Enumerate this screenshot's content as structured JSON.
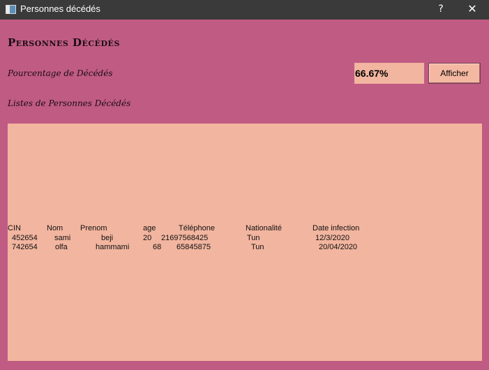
{
  "window": {
    "title": "Personnes décédés",
    "help_glyph": "?",
    "close_glyph": "✕"
  },
  "heading": "Personnes Décédés",
  "percentage": {
    "label": "Pourcentage de Décédés",
    "value": "66.67%",
    "button_label": "Afficher"
  },
  "list": {
    "label": "Listes de Personnes Décédés",
    "headers": [
      "CIN",
      "Nom",
      "Prenom",
      "age",
      "Téléphone",
      "Nationalité",
      "Date infection"
    ],
    "rows": [
      [
        "452654",
        "sami",
        "beji",
        "20",
        "21697568425",
        "Tun",
        "12/3/2020"
      ],
      [
        "742654",
        "olfa",
        "hammami",
        "68",
        "65845875",
        "Tun",
        "20/04/2020"
      ]
    ]
  },
  "colors": {
    "background": "#c05b84",
    "panel": "#f2b59f",
    "titlebar": "#3a3a3a"
  }
}
